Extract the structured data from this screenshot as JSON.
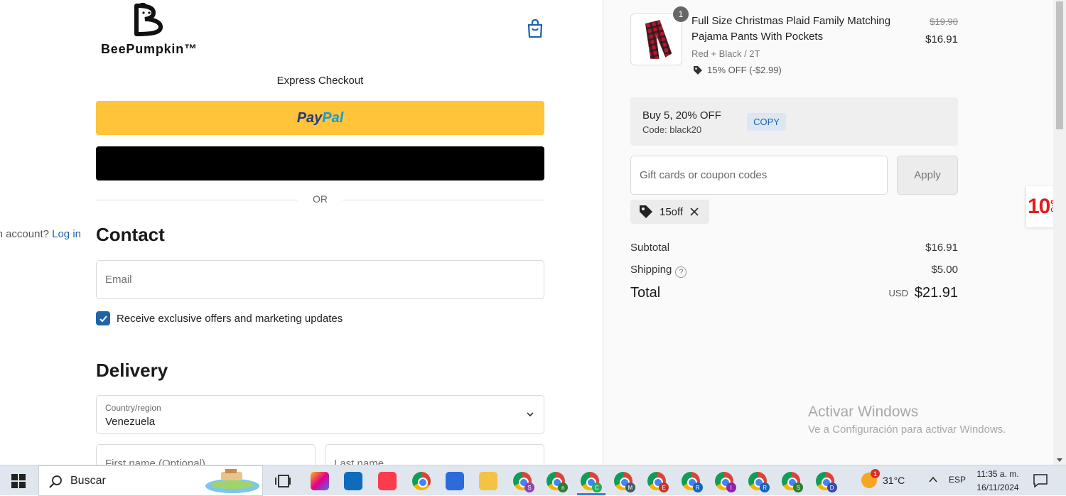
{
  "brand": {
    "name": "BeePumpkin™"
  },
  "checkout": {
    "express_label": "Express Checkout",
    "paypal_label_1": "Pay",
    "paypal_label_2": "Pal",
    "or_label": "OR",
    "contact_heading": "Contact",
    "account_prompt": "Already have an account?",
    "login_link": "Log in",
    "email_placeholder": "Email",
    "marketing_checkbox_label": "Receive exclusive offers and marketing updates",
    "marketing_checked": true,
    "delivery_heading": "Delivery",
    "country_label": "Country/region",
    "country_value": "Venezuela",
    "first_name_placeholder": "First name (Optional)",
    "last_name_placeholder": "Last name"
  },
  "order": {
    "item": {
      "quantity": "1",
      "title": "Full Size Christmas Plaid Family Matching Pajama Pants With Pockets",
      "variant": "Red + Black / 2T",
      "discount": "15% OFF (-$2.99)",
      "original_price": "$19.90",
      "price": "$16.91"
    },
    "promo": {
      "title": "Buy 5, 20% OFF",
      "code": "Code: black20",
      "copy_label": "COPY"
    },
    "coupon_placeholder": "Gift cards or coupon codes",
    "apply_label": "Apply",
    "applied_code": "15off",
    "subtotal_label": "Subtotal",
    "subtotal_value": "$16.91",
    "shipping_label": "Shipping",
    "shipping_value": "$5.00",
    "total_label": "Total",
    "total_currency": "USD",
    "total_value": "$21.91"
  },
  "side_badge": {
    "number": "10",
    "percent": "%",
    "off": "OFF"
  },
  "watermark": {
    "line1": "Activar Windows",
    "line2": "Ve a Configuración para activar Windows."
  },
  "taskbar": {
    "search_label": "Buscar",
    "apps": [
      {
        "name": "copilot",
        "color": "#7b61ff"
      },
      {
        "name": "outlook",
        "color": "#0f6cbd"
      },
      {
        "name": "itunes",
        "color": "#fa3c4c"
      },
      {
        "name": "chrome",
        "color": "#4285f4"
      },
      {
        "name": "store",
        "color": "#2d6bd9"
      },
      {
        "name": "explorer",
        "color": "#f3c343"
      }
    ],
    "chrome_profiles": [
      "S",
      "n",
      "C",
      "M",
      "E",
      "R",
      "I",
      "R",
      "S",
      "D"
    ],
    "temperature": "31°C",
    "weather_badge": "1",
    "language": "ESP",
    "time": "11:35 a. m.",
    "date": "16/11/2024"
  }
}
